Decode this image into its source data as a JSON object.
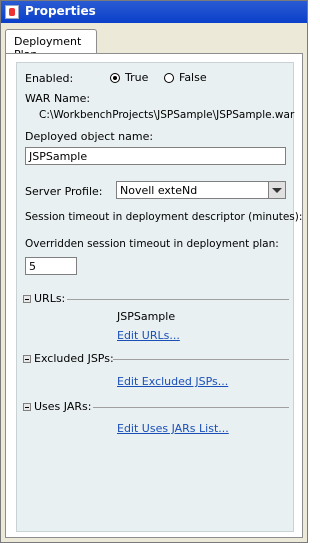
{
  "window": {
    "title": "Properties"
  },
  "tabs": [
    {
      "label": "Deployment Plan"
    }
  ],
  "enabled": {
    "label": "Enabled:",
    "options": [
      {
        "label": "True",
        "checked": true
      },
      {
        "label": "False",
        "checked": false
      }
    ]
  },
  "war": {
    "label": "WAR Name:",
    "path": "C:\\WorkbenchProjects\\JSPSample\\JSPSample.war"
  },
  "deployed_object": {
    "label": "Deployed object name:",
    "value": "JSPSample"
  },
  "server_profile": {
    "label": "Server Profile:",
    "selected": "Novell exteNd"
  },
  "session_timeout": {
    "label": "Session timeout in deployment descriptor (minutes):"
  },
  "overridden_timeout": {
    "label": "Overridden session timeout in deployment plan:",
    "value": "5"
  },
  "sections": {
    "urls": {
      "label": "URLs:",
      "value": "JSPSample",
      "link": "Edit URLs..."
    },
    "excluded_jsps": {
      "label": "Excluded JSPs:",
      "link": "Edit Excluded JSPs..."
    },
    "uses_jars": {
      "label": "Uses JARs:",
      "link": "Edit Uses JARs List..."
    }
  },
  "colors": {
    "titlebar": "#0a3fc9",
    "panel_bg": "#e8f0f2",
    "link": "#1b4fb8"
  },
  "icons": {
    "window_icon": "app-window-icon",
    "close": "close-icon",
    "dropdown": "chevron-down-icon",
    "collapse": "minus-icon"
  }
}
